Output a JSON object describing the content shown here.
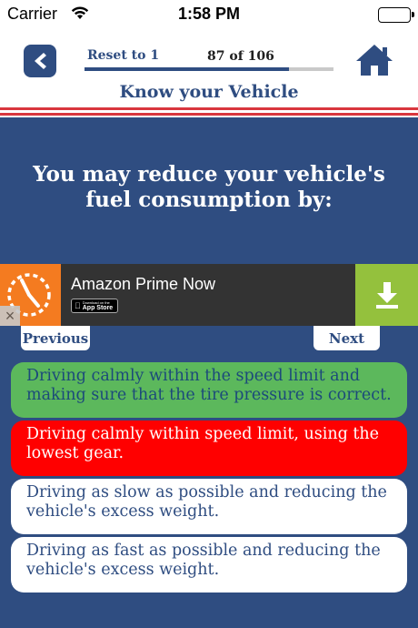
{
  "status_bar": {
    "carrier": "Carrier",
    "time": "1:58 PM"
  },
  "header": {
    "reset_label": "Reset to 1",
    "progress_text": "87 of 106",
    "progress_fraction": 0.82,
    "title": "Know your Vehicle"
  },
  "question": "You may reduce your vehicle's fuel consumption by:",
  "ad": {
    "title": "Amazon Prime Now",
    "badge_small": "Download on the",
    "badge_big": "App Store",
    "close_symbol": "×"
  },
  "nav": {
    "previous_label": "Previous",
    "next_label": "Next"
  },
  "answers": [
    {
      "text": "Driving calmly within the speed limit and making sure that the tire pressure is correct.",
      "state": "correct"
    },
    {
      "text": "Driving calmly within speed limit, using the lowest gear.",
      "state": "wrong"
    },
    {
      "text": "Driving as slow as possible and reducing the vehicle's excess weight.",
      "state": "neutral"
    },
    {
      "text": "Driving as fast as possible and reducing the vehicle's excess weight.",
      "state": "neutral"
    }
  ],
  "colors": {
    "primary": "#2f4d81",
    "correct": "#5cb85c",
    "wrong": "#ff0000",
    "ad_orange": "#f47b20",
    "ad_green": "#94c13d"
  },
  "icons": {
    "back": "back-arrow-icon",
    "home": "home-icon",
    "download": "download-icon",
    "ad_app": "clock-icon",
    "wifi": "wifi-icon",
    "battery": "battery-icon"
  }
}
